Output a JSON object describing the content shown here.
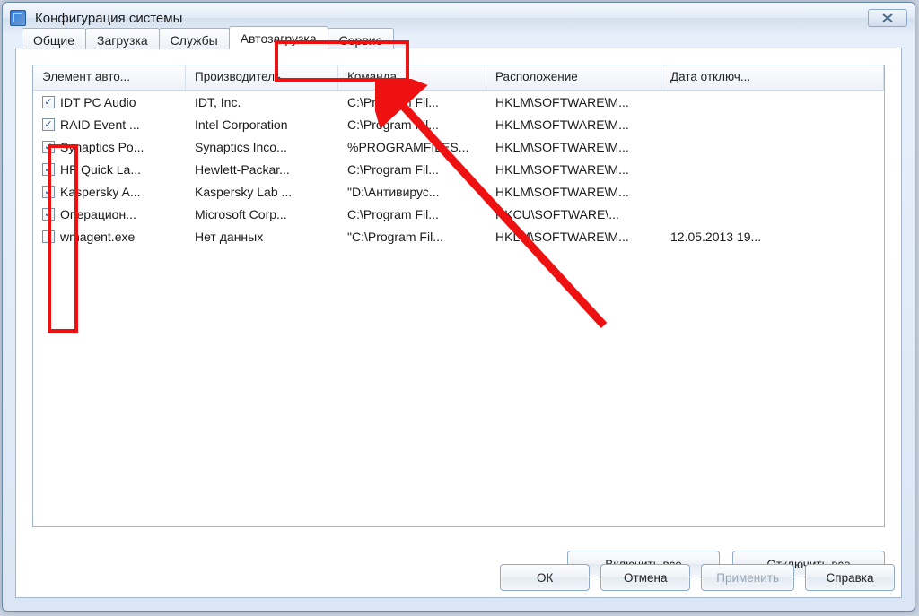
{
  "window": {
    "title": "Конфигурация системы"
  },
  "tabs": [
    {
      "label": "Общие"
    },
    {
      "label": "Загрузка"
    },
    {
      "label": "Службы"
    },
    {
      "label": "Автозагрузка",
      "active": true
    },
    {
      "label": "Сервис"
    }
  ],
  "columns": {
    "c0": "Элемент авто...",
    "c1": "Производитель",
    "c2": "Команда",
    "c3": "Расположение",
    "c4": "Дата отключ..."
  },
  "rows": [
    {
      "checked": true,
      "name": "IDT PC Audio",
      "vendor": "IDT, Inc.",
      "cmd": "C:\\Program Fil...",
      "loc": "HKLM\\SOFTWARE\\M...",
      "date": ""
    },
    {
      "checked": true,
      "name": "RAID Event ...",
      "vendor": "Intel Corporation",
      "cmd": "C:\\Program Fil...",
      "loc": "HKLM\\SOFTWARE\\M...",
      "date": ""
    },
    {
      "checked": true,
      "name": "Synaptics Po...",
      "vendor": "Synaptics Inco...",
      "cmd": "%PROGRAMFILES...",
      "loc": "HKLM\\SOFTWARE\\M...",
      "date": ""
    },
    {
      "checked": true,
      "name": "HP Quick La...",
      "vendor": "Hewlett-Packar...",
      "cmd": "C:\\Program Fil...",
      "loc": "HKLM\\SOFTWARE\\M...",
      "date": ""
    },
    {
      "checked": true,
      "name": "Kaspersky A...",
      "vendor": "Kaspersky Lab ...",
      "cmd": "\"D:\\Антивирус...",
      "loc": "HKLM\\SOFTWARE\\M...",
      "date": ""
    },
    {
      "checked": true,
      "name": "Операцион...",
      "vendor": "Microsoft Corp...",
      "cmd": "C:\\Program Fil...",
      "loc": "HKCU\\SOFTWARE\\...",
      "date": ""
    },
    {
      "checked": false,
      "name": "wmagent.exe",
      "vendor": "Нет данных",
      "cmd": "\"C:\\Program Fil...",
      "loc": "HKLM\\SOFTWARE\\M...",
      "date": "12.05.2013 19..."
    }
  ],
  "buttons": {
    "enable_all": "Включить все",
    "disable_all": "Отключить все",
    "ok": "ОК",
    "cancel": "Отмена",
    "apply": "Применить",
    "help": "Справка"
  }
}
